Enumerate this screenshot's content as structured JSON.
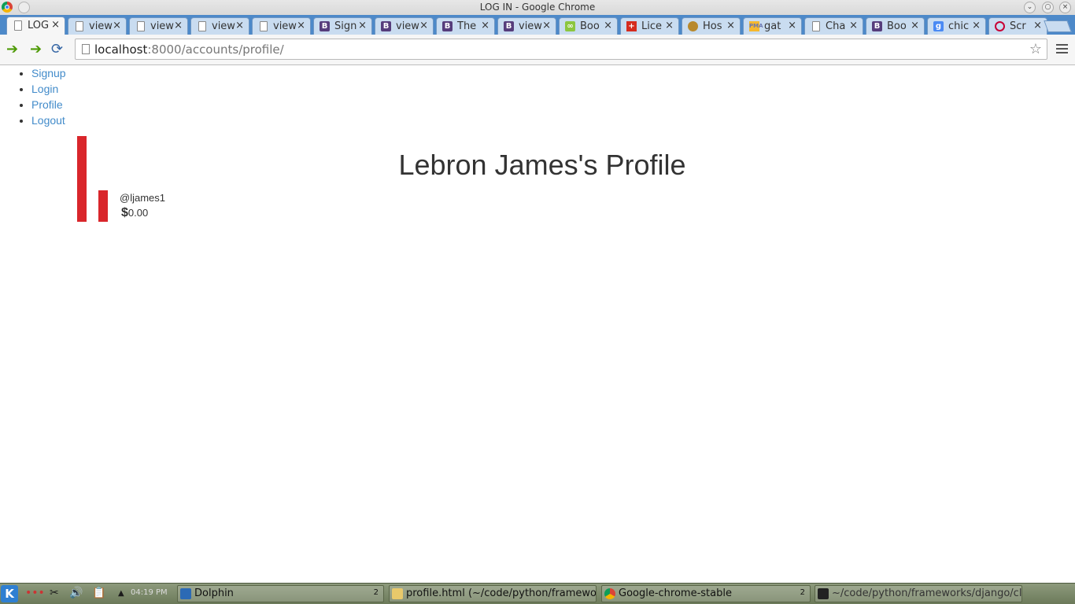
{
  "window": {
    "title": "LOG IN - Google Chrome"
  },
  "tabs": [
    {
      "label": "LOG",
      "favicon": "page-icon",
      "active": true
    },
    {
      "label": "view",
      "favicon": "page-icon"
    },
    {
      "label": "view",
      "favicon": "page-icon"
    },
    {
      "label": "view",
      "favicon": "page-icon"
    },
    {
      "label": "view",
      "favicon": "page-icon"
    },
    {
      "label": "Sign",
      "favicon": "bootstrap-icon"
    },
    {
      "label": "view",
      "favicon": "bootstrap-icon"
    },
    {
      "label": "The",
      "favicon": "bootstrap-icon"
    },
    {
      "label": "view",
      "favicon": "bootstrap-icon"
    },
    {
      "label": "Boo",
      "favicon": "green-icon"
    },
    {
      "label": "Lice",
      "favicon": "swiss-cross-icon"
    },
    {
      "label": "Hos",
      "favicon": "cat-icon"
    },
    {
      "label": "gat",
      "favicon": "pma-icon"
    },
    {
      "label": "Cha",
      "favicon": "page-icon"
    },
    {
      "label": "Boo",
      "favicon": "bootstrap-icon"
    },
    {
      "label": "chic",
      "favicon": "google-icon"
    },
    {
      "label": "Scr",
      "favicon": "debian-icon"
    }
  ],
  "address_bar": {
    "host": "localhost",
    "rest": ":8000/accounts/profile/"
  },
  "nav_links": [
    "Signup",
    "Login",
    "Profile",
    "Logout"
  ],
  "profile": {
    "heading": "Lebron James's Profile",
    "handle": "@ljames1",
    "currency_symbol": "$",
    "balance": "0.00"
  },
  "taskbar": {
    "clock": "04:19 PM",
    "tasks": [
      {
        "label": "Dolphin",
        "count": "2"
      },
      {
        "label": "profile.html (~/code/python/framework",
        "count": ""
      },
      {
        "label": "Google-chrome-stable",
        "count": "2"
      },
      {
        "label": "~/code/python/frameworks/django/cl",
        "count": ""
      }
    ]
  },
  "colors": {
    "link": "#428bca",
    "bar": "#d9262b",
    "tabstrip": "#4d89c9"
  }
}
